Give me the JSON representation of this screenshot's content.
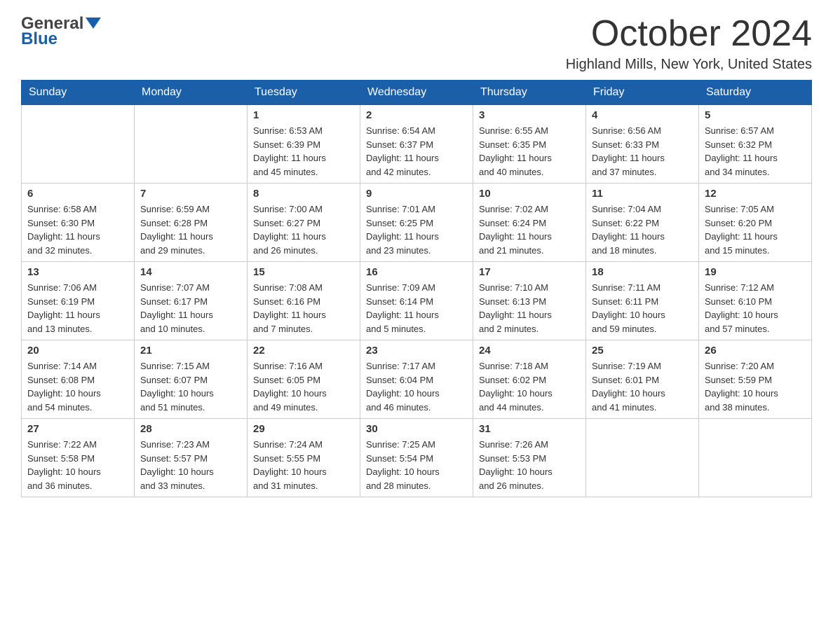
{
  "header": {
    "logo_general": "General",
    "logo_blue": "Blue",
    "title": "October 2024",
    "subtitle": "Highland Mills, New York, United States"
  },
  "calendar": {
    "days_of_week": [
      "Sunday",
      "Monday",
      "Tuesday",
      "Wednesday",
      "Thursday",
      "Friday",
      "Saturday"
    ],
    "weeks": [
      [
        {
          "day": "",
          "info": ""
        },
        {
          "day": "",
          "info": ""
        },
        {
          "day": "1",
          "info": "Sunrise: 6:53 AM\nSunset: 6:39 PM\nDaylight: 11 hours\nand 45 minutes."
        },
        {
          "day": "2",
          "info": "Sunrise: 6:54 AM\nSunset: 6:37 PM\nDaylight: 11 hours\nand 42 minutes."
        },
        {
          "day": "3",
          "info": "Sunrise: 6:55 AM\nSunset: 6:35 PM\nDaylight: 11 hours\nand 40 minutes."
        },
        {
          "day": "4",
          "info": "Sunrise: 6:56 AM\nSunset: 6:33 PM\nDaylight: 11 hours\nand 37 minutes."
        },
        {
          "day": "5",
          "info": "Sunrise: 6:57 AM\nSunset: 6:32 PM\nDaylight: 11 hours\nand 34 minutes."
        }
      ],
      [
        {
          "day": "6",
          "info": "Sunrise: 6:58 AM\nSunset: 6:30 PM\nDaylight: 11 hours\nand 32 minutes."
        },
        {
          "day": "7",
          "info": "Sunrise: 6:59 AM\nSunset: 6:28 PM\nDaylight: 11 hours\nand 29 minutes."
        },
        {
          "day": "8",
          "info": "Sunrise: 7:00 AM\nSunset: 6:27 PM\nDaylight: 11 hours\nand 26 minutes."
        },
        {
          "day": "9",
          "info": "Sunrise: 7:01 AM\nSunset: 6:25 PM\nDaylight: 11 hours\nand 23 minutes."
        },
        {
          "day": "10",
          "info": "Sunrise: 7:02 AM\nSunset: 6:24 PM\nDaylight: 11 hours\nand 21 minutes."
        },
        {
          "day": "11",
          "info": "Sunrise: 7:04 AM\nSunset: 6:22 PM\nDaylight: 11 hours\nand 18 minutes."
        },
        {
          "day": "12",
          "info": "Sunrise: 7:05 AM\nSunset: 6:20 PM\nDaylight: 11 hours\nand 15 minutes."
        }
      ],
      [
        {
          "day": "13",
          "info": "Sunrise: 7:06 AM\nSunset: 6:19 PM\nDaylight: 11 hours\nand 13 minutes."
        },
        {
          "day": "14",
          "info": "Sunrise: 7:07 AM\nSunset: 6:17 PM\nDaylight: 11 hours\nand 10 minutes."
        },
        {
          "day": "15",
          "info": "Sunrise: 7:08 AM\nSunset: 6:16 PM\nDaylight: 11 hours\nand 7 minutes."
        },
        {
          "day": "16",
          "info": "Sunrise: 7:09 AM\nSunset: 6:14 PM\nDaylight: 11 hours\nand 5 minutes."
        },
        {
          "day": "17",
          "info": "Sunrise: 7:10 AM\nSunset: 6:13 PM\nDaylight: 11 hours\nand 2 minutes."
        },
        {
          "day": "18",
          "info": "Sunrise: 7:11 AM\nSunset: 6:11 PM\nDaylight: 10 hours\nand 59 minutes."
        },
        {
          "day": "19",
          "info": "Sunrise: 7:12 AM\nSunset: 6:10 PM\nDaylight: 10 hours\nand 57 minutes."
        }
      ],
      [
        {
          "day": "20",
          "info": "Sunrise: 7:14 AM\nSunset: 6:08 PM\nDaylight: 10 hours\nand 54 minutes."
        },
        {
          "day": "21",
          "info": "Sunrise: 7:15 AM\nSunset: 6:07 PM\nDaylight: 10 hours\nand 51 minutes."
        },
        {
          "day": "22",
          "info": "Sunrise: 7:16 AM\nSunset: 6:05 PM\nDaylight: 10 hours\nand 49 minutes."
        },
        {
          "day": "23",
          "info": "Sunrise: 7:17 AM\nSunset: 6:04 PM\nDaylight: 10 hours\nand 46 minutes."
        },
        {
          "day": "24",
          "info": "Sunrise: 7:18 AM\nSunset: 6:02 PM\nDaylight: 10 hours\nand 44 minutes."
        },
        {
          "day": "25",
          "info": "Sunrise: 7:19 AM\nSunset: 6:01 PM\nDaylight: 10 hours\nand 41 minutes."
        },
        {
          "day": "26",
          "info": "Sunrise: 7:20 AM\nSunset: 5:59 PM\nDaylight: 10 hours\nand 38 minutes."
        }
      ],
      [
        {
          "day": "27",
          "info": "Sunrise: 7:22 AM\nSunset: 5:58 PM\nDaylight: 10 hours\nand 36 minutes."
        },
        {
          "day": "28",
          "info": "Sunrise: 7:23 AM\nSunset: 5:57 PM\nDaylight: 10 hours\nand 33 minutes."
        },
        {
          "day": "29",
          "info": "Sunrise: 7:24 AM\nSunset: 5:55 PM\nDaylight: 10 hours\nand 31 minutes."
        },
        {
          "day": "30",
          "info": "Sunrise: 7:25 AM\nSunset: 5:54 PM\nDaylight: 10 hours\nand 28 minutes."
        },
        {
          "day": "31",
          "info": "Sunrise: 7:26 AM\nSunset: 5:53 PM\nDaylight: 10 hours\nand 26 minutes."
        },
        {
          "day": "",
          "info": ""
        },
        {
          "day": "",
          "info": ""
        }
      ]
    ]
  }
}
